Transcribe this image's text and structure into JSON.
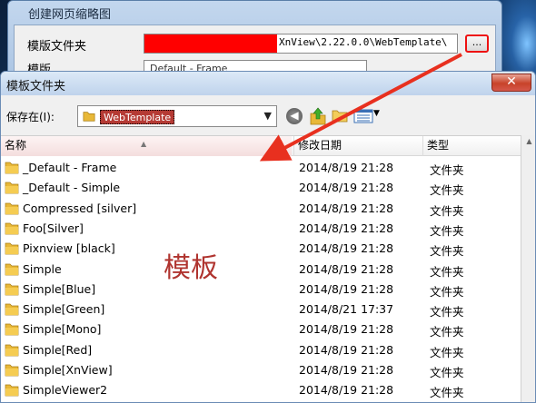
{
  "thumbnail_dialog": {
    "title": "创建网页缩略图",
    "template_folder_label": "模版文件夹",
    "template_path": "XnView\\2.22.0.0\\WebTemplate\\",
    "browse_label": "...",
    "template_label": "模版",
    "template_value": "Default - Frame"
  },
  "folder_dialog": {
    "title": "模板文件夹",
    "close_label": "✕",
    "save_in_label": "保存在(I):",
    "location": "WebTemplate",
    "columns": {
      "name": "名称",
      "date": "修改日期",
      "type": "类型"
    },
    "rows": [
      {
        "name": "_Default - Frame",
        "date": "2014/8/19 21:28",
        "type": "文件夹"
      },
      {
        "name": "_Default - Simple",
        "date": "2014/8/19 21:28",
        "type": "文件夹"
      },
      {
        "name": "Compressed [silver]",
        "date": "2014/8/19 21:28",
        "type": "文件夹"
      },
      {
        "name": "Foo[Silver]",
        "date": "2014/8/19 21:28",
        "type": "文件夹"
      },
      {
        "name": "Pixnview [black]",
        "date": "2014/8/19 21:28",
        "type": "文件夹"
      },
      {
        "name": "Simple",
        "date": "2014/8/19 21:28",
        "type": "文件夹"
      },
      {
        "name": "Simple[Blue]",
        "date": "2014/8/19 21:28",
        "type": "文件夹"
      },
      {
        "name": "Simple[Green]",
        "date": "2014/8/21 17:37",
        "type": "文件夹"
      },
      {
        "name": "Simple[Mono]",
        "date": "2014/8/19 21:28",
        "type": "文件夹"
      },
      {
        "name": "Simple[Red]",
        "date": "2014/8/19 21:28",
        "type": "文件夹"
      },
      {
        "name": "Simple[XnView]",
        "date": "2014/8/19 21:28",
        "type": "文件夹"
      },
      {
        "name": "SimpleViewer2",
        "date": "2014/8/19 21:28",
        "type": "文件夹"
      }
    ]
  },
  "annotation_text": "模板",
  "colors": {
    "highlight_red": "#ff0000",
    "annotation_red": "#b0342f",
    "folder_yellow": "#e8b838"
  }
}
